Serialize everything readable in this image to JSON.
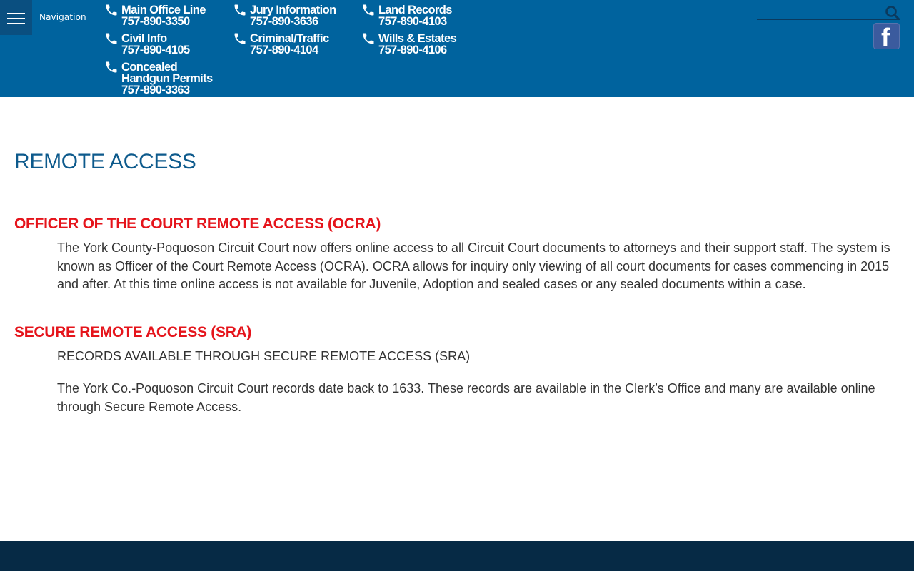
{
  "header": {
    "nav_label": "Navigation",
    "contacts": [
      {
        "id": "main-office-line",
        "lines": [
          "Main Office Line",
          "757-890-3350"
        ]
      },
      {
        "id": "civil-info",
        "lines": [
          "Civil Info",
          "757-890-4105"
        ]
      },
      {
        "id": "concealed-handgun-permits",
        "lines": [
          "Concealed",
          "Handgun Permits",
          "757-890-3363"
        ]
      },
      {
        "id": "jury-information",
        "lines": [
          "Jury Information",
          "757-890-3636"
        ]
      },
      {
        "id": "criminal-traffic",
        "lines": [
          "Criminal/Traffic",
          "757-890-4104"
        ]
      },
      {
        "id": "land-records",
        "lines": [
          "Land Records",
          "757-890-4103"
        ]
      },
      {
        "id": "wills-estates",
        "lines": [
          "Wills & Estates",
          "757-890-4106"
        ]
      }
    ],
    "search": {
      "placeholder": "",
      "icon": "search-icon"
    },
    "social": {
      "icon": "facebook-icon",
      "glyph": "f"
    }
  },
  "main": {
    "title": "REMOTE ACCESS",
    "sections": [
      {
        "heading": "OFFICER OF THE COURT REMOTE ACCESS (OCRA)",
        "paragraphs": [
          "The York County-Poquoson Circuit Court now offers online access to all Circuit Court documents to attorneys and their support staff. The system is known as Officer of the Court Remote Access (OCRA). OCRA allows for inquiry only viewing of all court documents for cases commencing in 2015 and after. At this time online access is not available for Juvenile, Adoption and sealed cases or any sealed documents within a case."
        ]
      },
      {
        "heading": "SECURE REMOTE ACCESS (SRA)",
        "paragraphs": [
          "RECORDS AVAILABLE THROUGH SECURE REMOTE ACCESS (SRA)",
          "The York Co.-Poquoson Circuit Court records date back to 1633. These records are available in the Clerk’s Office and many are available online through Secure Remote Access."
        ]
      }
    ]
  },
  "colors": {
    "header_bg": "#00639e",
    "menu_bg": "#0a4f80",
    "title": "#0d5a8c",
    "section_heading": "#e5141b",
    "footer_bg": "#062a45",
    "facebook": "#3b5b9e"
  }
}
